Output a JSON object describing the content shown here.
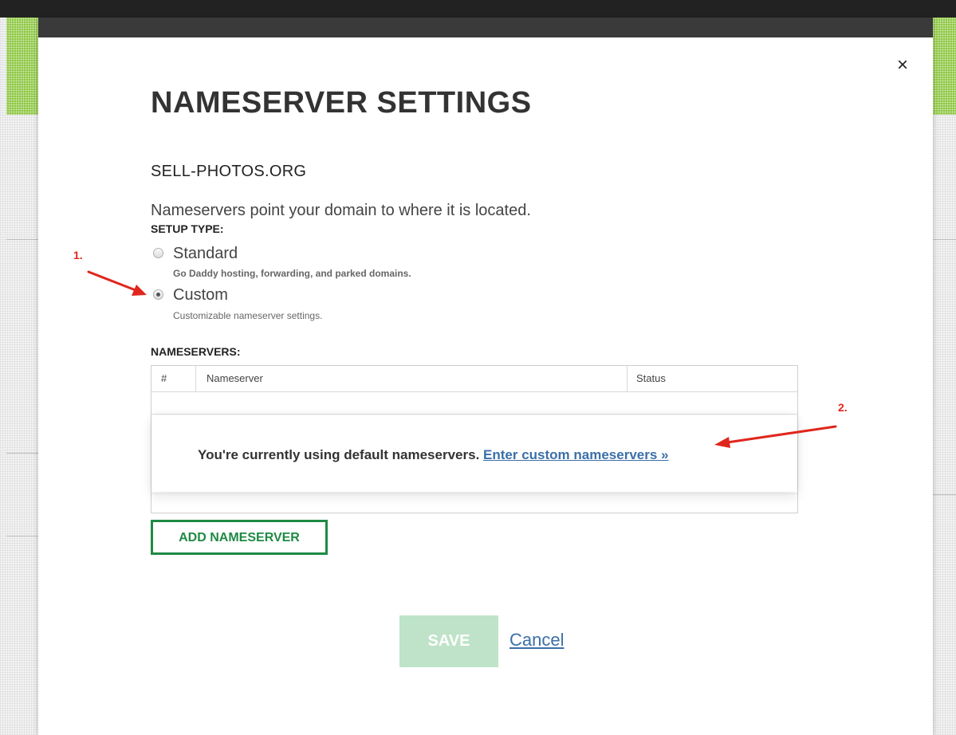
{
  "modal": {
    "title": "NAMESERVER SETTINGS",
    "domain": "SELL-PHOTOS.ORG",
    "description": "Nameservers point your domain to where it is located.",
    "close_icon": "×"
  },
  "setup": {
    "label": "SETUP TYPE:",
    "options": [
      {
        "label": "Standard",
        "description": "Go Daddy hosting, forwarding, and parked domains.",
        "selected": false
      },
      {
        "label": "Custom",
        "description": "Customizable nameserver settings.",
        "selected": true
      }
    ]
  },
  "nameservers": {
    "label": "NAMESERVERS:",
    "columns": [
      "#",
      "Nameserver",
      "Status"
    ],
    "empty_message": "You're currently using default nameservers.",
    "custom_link": "Enter custom nameservers »",
    "add_button": "ADD NAMESERVER"
  },
  "actions": {
    "save": "SAVE",
    "cancel": "Cancel"
  },
  "annotations": {
    "step1": "1.",
    "step2": "2.",
    "arrow_color": "#e0261d"
  },
  "colors": {
    "accent_green": "#1f8a44",
    "save_disabled": "#bfe3c8",
    "link_blue": "#3c6fa8",
    "topbar": "#3a3a3a"
  }
}
